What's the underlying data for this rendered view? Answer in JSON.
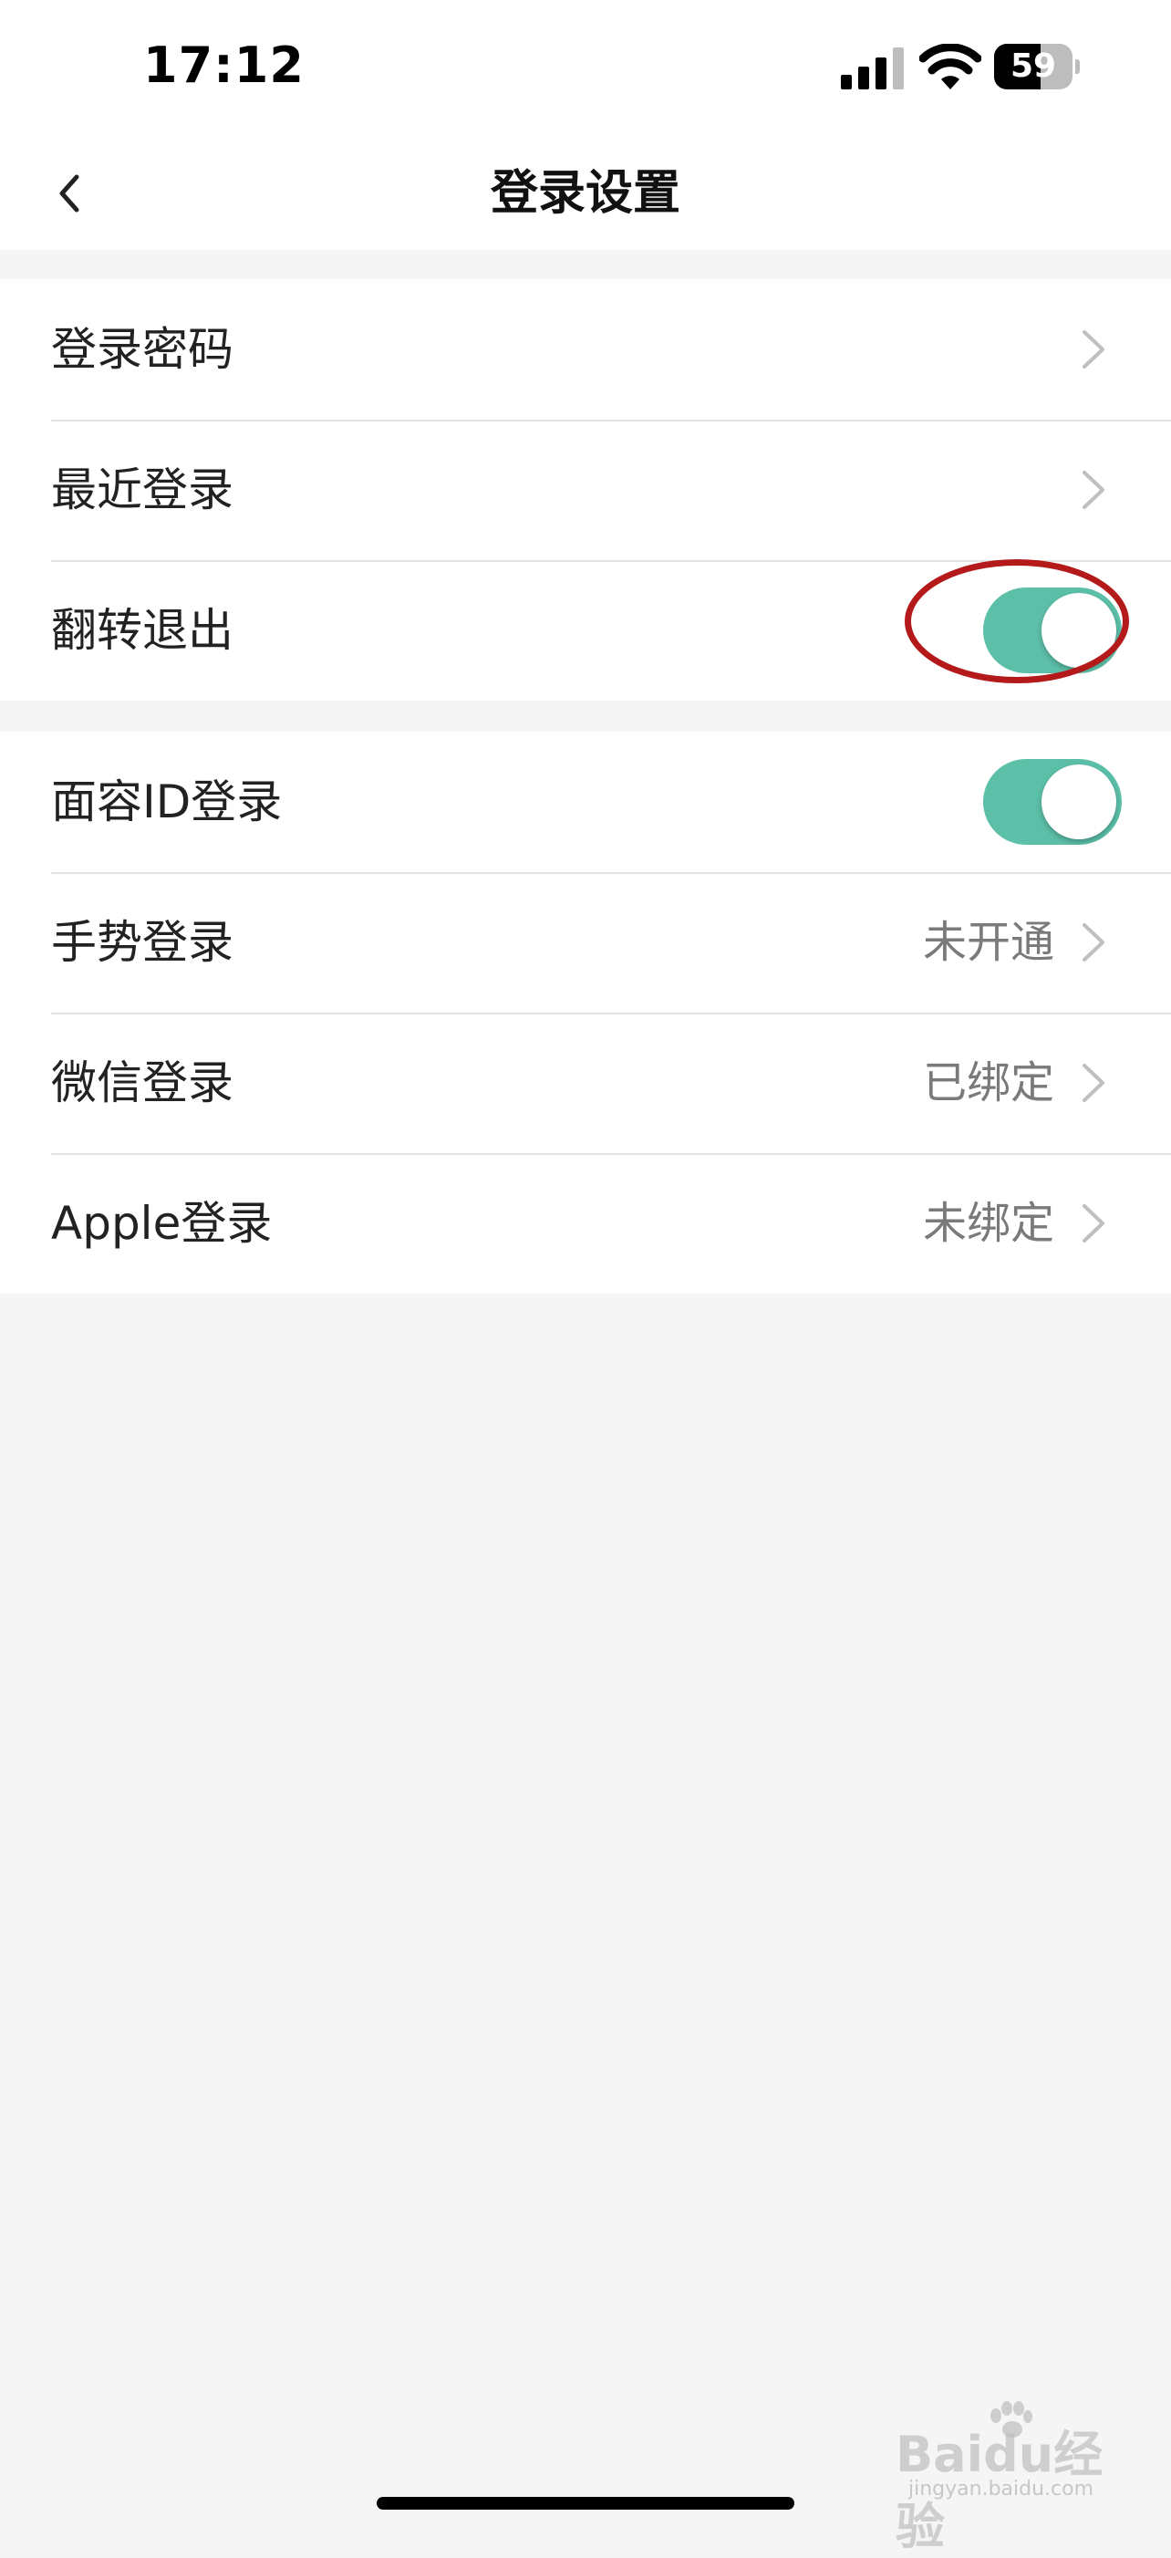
{
  "status_bar": {
    "time": "17:12",
    "battery_level": 59,
    "battery_text": "59"
  },
  "nav": {
    "title": "登录设置",
    "back_icon": "chevron-left-icon"
  },
  "groups": [
    {
      "rows": [
        {
          "label": "登录密码",
          "type": "link",
          "icon": "chevron-right-icon"
        },
        {
          "label": "最近登录",
          "type": "link",
          "icon": "chevron-right-icon"
        },
        {
          "label": "翻转退出",
          "type": "toggle",
          "on": true,
          "highlighted": true
        }
      ]
    },
    {
      "rows": [
        {
          "label": "面容ID登录",
          "type": "toggle",
          "on": true
        },
        {
          "label": "手势登录",
          "value": "未开通",
          "type": "link",
          "icon": "chevron-right-icon"
        },
        {
          "label": "微信登录",
          "value": "已绑定",
          "type": "link",
          "icon": "chevron-right-icon"
        },
        {
          "label": "Apple登录",
          "value": "未绑定",
          "type": "link",
          "icon": "chevron-right-icon"
        }
      ]
    }
  ],
  "colors": {
    "toggle_on": "#5cbfa8",
    "highlight_ring": "#b41a1a",
    "background": "#f5f5f5"
  },
  "watermark": {
    "text": "Baidu经验",
    "url_text": "jingyan.baidu.com"
  }
}
